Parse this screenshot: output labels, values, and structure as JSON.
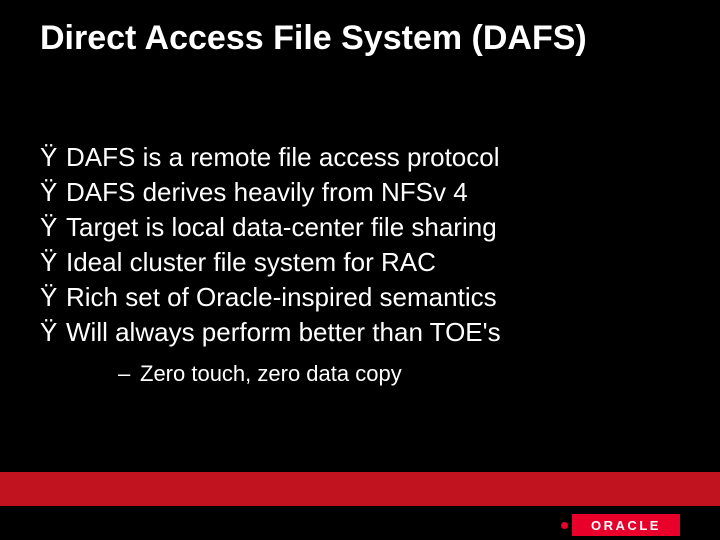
{
  "title": "Direct Access File System (DAFS)",
  "bullet_mark": "Ÿ",
  "bullets": [
    "DAFS is a remote file access protocol",
    "DAFS derives heavily from NFSv 4",
    "Target is local data-center file sharing",
    "Ideal cluster file system for RAC",
    "Rich set of Oracle-inspired semantics",
    "Will always perform better than TOE's"
  ],
  "sub_dash": "–",
  "sub_bullet": "Zero touch, zero data copy",
  "logo_text": "ORACLE"
}
